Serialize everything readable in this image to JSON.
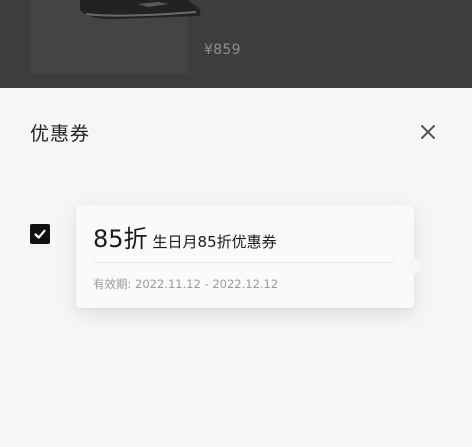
{
  "background": {
    "product": {
      "price": "¥859"
    }
  },
  "sheet": {
    "title": "优惠券",
    "close_icon": "close-icon"
  },
  "coupons": [
    {
      "selected": true,
      "discount": "85折",
      "name": "生日月85折优惠券",
      "validity": "有效期: 2022.11.12 - 2022.12.12"
    }
  ],
  "colors": {
    "backdrop": "#3d3d3d",
    "checkbox": "#111111",
    "text_primary": "#222222",
    "text_secondary": "#9a9a9a"
  }
}
